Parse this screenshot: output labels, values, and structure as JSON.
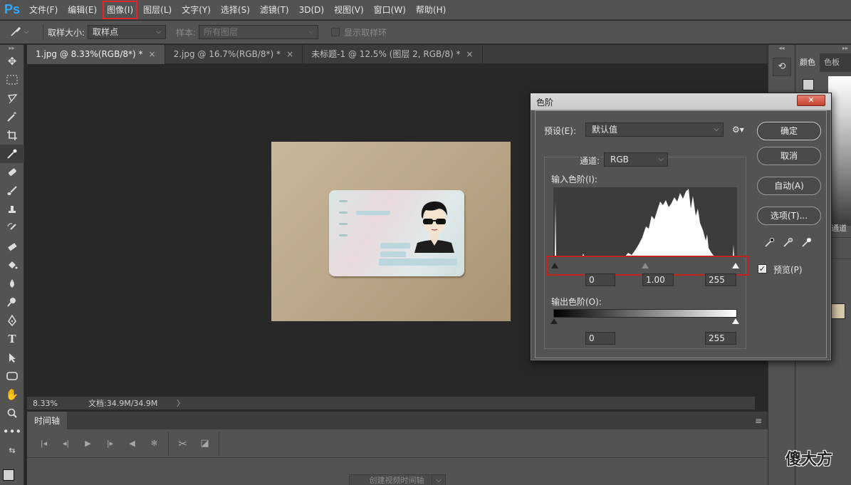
{
  "app": {
    "logo": "Ps"
  },
  "menu": {
    "items": [
      "文件(F)",
      "编辑(E)",
      "图像(I)",
      "图层(L)",
      "文字(Y)",
      "选择(S)",
      "滤镜(T)",
      "3D(D)",
      "视图(V)",
      "窗口(W)",
      "帮助(H)"
    ],
    "highlighted": "图像(I)"
  },
  "options": {
    "sample_size_label": "取样大小:",
    "sample_size_value": "取样点",
    "sample_label": "样本:",
    "sample_value": "所有图层",
    "show_ring_label": "显示取样环"
  },
  "tabs": [
    {
      "label": "1.jpg @ 8.33%(RGB/8*) *",
      "active": true
    },
    {
      "label": "2.jpg @ 16.7%(RGB/8*) *",
      "active": false
    },
    {
      "label": "未标题-1 @ 12.5% (图层 2, RGB/8) *",
      "active": false
    }
  ],
  "status": {
    "zoom": "8.33%",
    "doc": "文档:34.9M/34.9M",
    "arrow": "〉"
  },
  "timeline": {
    "tab": "时间轴",
    "create_button": "创建视频时间轴"
  },
  "right_panel": {
    "tabs": [
      "颜色",
      "色板"
    ],
    "partial_text": "通道"
  },
  "levels_dialog": {
    "title": "色阶",
    "close": "✕",
    "preset_label": "预设(E):",
    "preset_value": "默认值",
    "channel_label": "通道:",
    "channel_value": "RGB",
    "input_label": "输入色阶(I):",
    "input_values": {
      "black": "0",
      "gamma": "1.00",
      "white": "255"
    },
    "output_label": "输出色阶(O):",
    "output_values": {
      "black": "0",
      "white": "255"
    },
    "buttons": {
      "ok": "确定",
      "cancel": "取消",
      "auto": "自动(A)",
      "options": "选项(T)..."
    },
    "preview_label": "预览(P)",
    "preview_checked": true
  },
  "watermark": "傻大方",
  "colors": {
    "accent_red": "#c2231f",
    "ps_blue": "#31a8ff",
    "ui_gray": "#535353",
    "canvas_bg": "#282828"
  }
}
